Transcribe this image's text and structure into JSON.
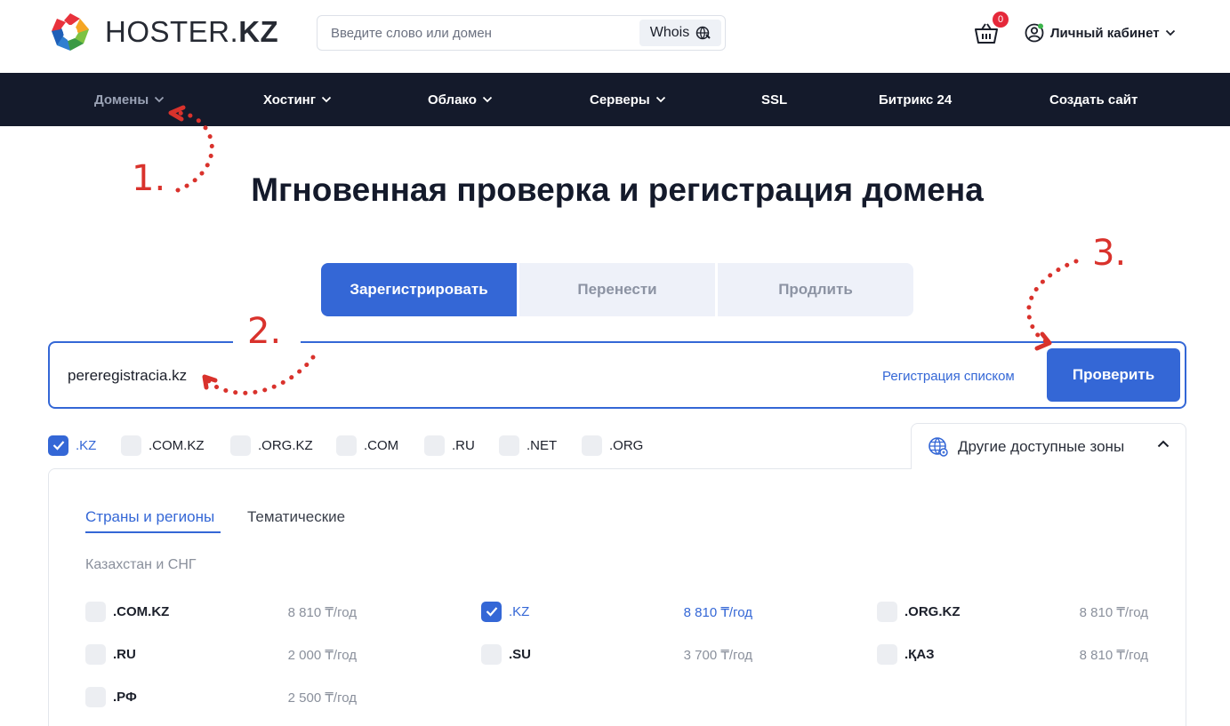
{
  "header": {
    "logo_name": "HOSTER.",
    "logo_tld": "KZ",
    "search": {
      "placeholder": "Введите слово или домен",
      "value": ""
    },
    "whois_label": "Whois",
    "cart_count": "0",
    "account_label": "Личный кабинет"
  },
  "nav": {
    "items": [
      {
        "label": "Домены"
      },
      {
        "label": "Хостинг"
      },
      {
        "label": "Облако"
      },
      {
        "label": "Серверы"
      },
      {
        "label": "SSL"
      },
      {
        "label": "Битрикс 24"
      },
      {
        "label": "Создать сайт"
      }
    ]
  },
  "main": {
    "title": "Мгновенная проверка и регистрация домена",
    "tabs": [
      {
        "label": "Зарегистрировать"
      },
      {
        "label": "Перенести"
      },
      {
        "label": "Продлить"
      }
    ],
    "domain_input": {
      "value": "pereregistracia.kz"
    },
    "bulk_link": "Регистрация списком",
    "check_button": "Проверить",
    "quick_zones": [
      {
        "label": ".KZ",
        "checked": true
      },
      {
        "label": ".COM.KZ",
        "checked": false
      },
      {
        "label": ".ORG.KZ",
        "checked": false
      },
      {
        "label": ".COM",
        "checked": false
      },
      {
        "label": ".RU",
        "checked": false
      },
      {
        "label": ".NET",
        "checked": false
      },
      {
        "label": ".ORG",
        "checked": false
      }
    ],
    "other_zones_label": "Другие доступные зоны",
    "panel": {
      "sub_tabs": [
        {
          "label": "Страны и регионы"
        },
        {
          "label": "Тематические"
        }
      ],
      "region_title": "Казахстан и СНГ",
      "domains": [
        {
          "name": ".COM.KZ",
          "price": "8 810 ₸/год",
          "checked": false
        },
        {
          "name": ".KZ",
          "price": "8 810 ₸/год",
          "checked": true
        },
        {
          "name": ".ORG.KZ",
          "price": "8 810 ₸/год",
          "checked": false
        },
        {
          "name": ".RU",
          "price": "2 000 ₸/год",
          "checked": false
        },
        {
          "name": ".SU",
          "price": "3 700 ₸/год",
          "checked": false
        },
        {
          "name": ".ҚАЗ",
          "price": "8 810 ₸/год",
          "checked": false
        },
        {
          "name": ".РФ",
          "price": "2 500 ₸/год",
          "checked": false
        }
      ]
    }
  },
  "annotations": {
    "step1": "1.",
    "step2": "2.",
    "step3": "3.",
    "color": "#d9322c"
  },
  "colors": {
    "accent": "#3467d6",
    "nav_bg": "#141a2b",
    "badge": "#e5283a"
  }
}
